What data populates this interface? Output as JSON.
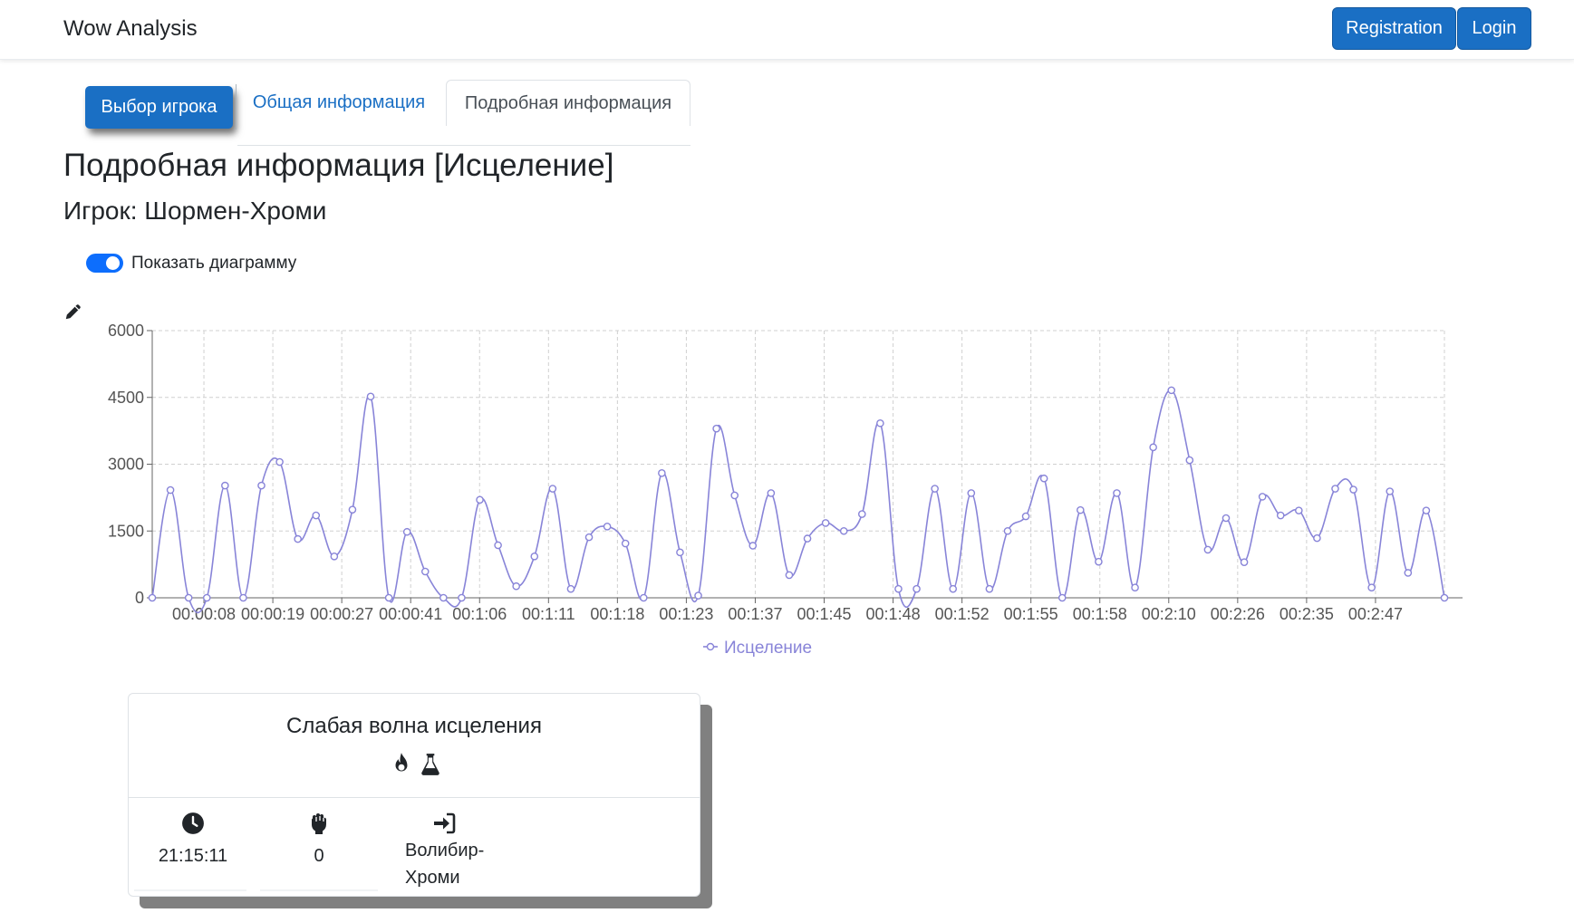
{
  "navbar": {
    "brand": "Wow Analysis",
    "registration_label": "Registration",
    "login_label": "Login"
  },
  "tabs": {
    "select_player": "Выбор игрока",
    "general_info": "Общая информация",
    "detailed_info": "Подробная информация"
  },
  "header": {
    "title": "Подробная информация [Исцеление]",
    "player": "Игрок: Шормен-Хроми"
  },
  "toggle": {
    "label": "Показать диаграмму",
    "on": true
  },
  "icons": {
    "edit": "pencil-icon",
    "school_fire": "fire-icon",
    "school_nature": "flask-icon",
    "time": "clock-icon",
    "count": "fist-icon",
    "target": "sign-in-icon"
  },
  "colors": {
    "primary": "#1a6fc4",
    "series": "#8884d8",
    "toggle": "#0d6efd"
  },
  "chart_data": {
    "type": "line",
    "ylim": [
      0,
      6000
    ],
    "yticks": [
      0,
      1500,
      3000,
      4500,
      6000
    ],
    "xticks": [
      "00:00:08",
      "00:00:19",
      "00:00:27",
      "00:00:41",
      "00:1:06",
      "00:1:11",
      "00:1:18",
      "00:1:23",
      "00:1:37",
      "00:1:45",
      "00:1:48",
      "00:1:52",
      "00:1:55",
      "00:1:58",
      "00:2:10",
      "00:2:26",
      "00:2:35",
      "00:2:47"
    ],
    "grid": true,
    "legend": "bottom",
    "series": [
      {
        "name": "Исцеление",
        "values": [
          0,
          2420,
          0,
          0,
          2520,
          0,
          2520,
          3050,
          1320,
          1850,
          930,
          1980,
          4520,
          0,
          1480,
          590,
          0,
          0,
          2200,
          1180,
          260,
          930,
          2450,
          200,
          1360,
          1600,
          1220,
          0,
          2800,
          1020,
          50,
          3800,
          2300,
          1170,
          2350,
          510,
          1330,
          1680,
          1500,
          1880,
          3920,
          200,
          200,
          2450,
          200,
          2350,
          200,
          1500,
          1830,
          2680,
          0,
          1970,
          810,
          2350,
          230,
          3380,
          4660,
          3090,
          1080,
          1790,
          800,
          2270,
          1850,
          1960,
          1340,
          2450,
          2430,
          230,
          2390,
          560,
          1960,
          0
        ]
      }
    ]
  },
  "card": {
    "title": "Слабая волна исцеления",
    "time": "21:15:11",
    "count": "0",
    "target": "Волибир-Хроми"
  }
}
